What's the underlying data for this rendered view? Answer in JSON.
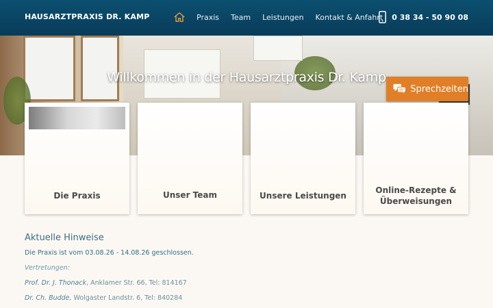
{
  "header": {
    "brand": "HAUSARZTPRAXIS DR. KAMP",
    "nav": [
      "Praxis",
      "Team",
      "Leistungen",
      "Kontakt & Anfahrt"
    ],
    "phone": "0 38 34 - 50 90 08"
  },
  "hero": {
    "title": "Willkommen in der Hausarztpraxis Dr. Kamp",
    "sprechzeiten": "Sprechzeiten"
  },
  "cards": [
    {
      "label": "Die Praxis"
    },
    {
      "label": "Unser Team"
    },
    {
      "label": "Unsere Leistungen"
    },
    {
      "label_line1": "Online-Rezepte &",
      "label_line2": "Überweisungen"
    }
  ],
  "notes": {
    "heading": "Aktuelle Hinweise",
    "closed": "Die Praxis ist vom 03.08.26 - 14.08.26 geschlossen.",
    "vertretungen": "Vertretungen:",
    "rep1_name": "Prof. Dr. J. Thonack",
    "rep1_addr": ", Anklamer Str. 66, Tel: 814167",
    "rep2_name": "Dr. Ch. Budde,",
    "rep2_addr": " Wolgaster Landstr. 6, Tel: 840284"
  },
  "colors": {
    "header": "#0c4f70",
    "accent": "#e07f27",
    "text_link": "#2f6e86"
  }
}
